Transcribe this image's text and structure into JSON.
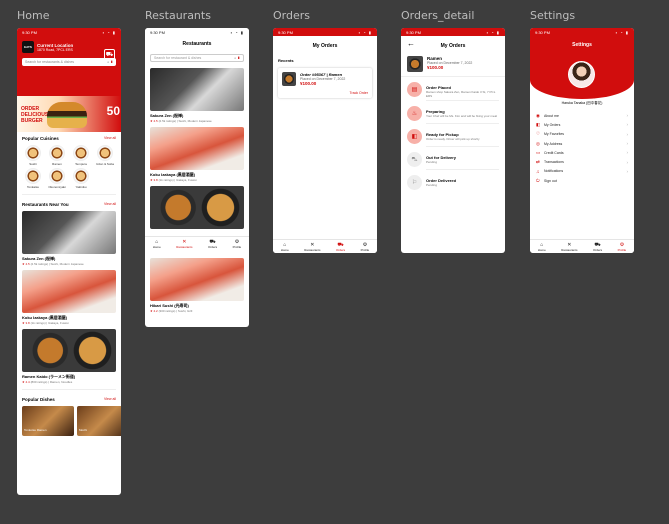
{
  "frames": {
    "home": "Home",
    "restaurants": "Restaurants",
    "orders": "Orders",
    "orders_detail": "Orders_detail",
    "settings": "Settings"
  },
  "status": {
    "time": "9:30 PM"
  },
  "home": {
    "location_title": "Current Location",
    "location_sub": "1870 Road, 7PCL ERS",
    "logo": "EATS",
    "search_placeholder": "Search for restaurants & dishes",
    "banner_text1": "ORDER",
    "banner_text2": "DELICIOUS",
    "banner_text3": "BURGER",
    "banner_discount": "50",
    "popular_cuisines": "Popular Cuisines",
    "view_all": "View all",
    "cuisines": [
      {
        "label": "Sushi"
      },
      {
        "label": "Ramen"
      },
      {
        "label": "Tempura"
      },
      {
        "label": "Udon & Soba"
      },
      {
        "label": "Tonkatsu"
      },
      {
        "label": "Okonomiyaki"
      },
      {
        "label": "Yakiniku"
      }
    ],
    "restaurants_near": "Restaurants Near You",
    "restaurants": [
      {
        "name": "Sakura Zen (桜禅)",
        "rating": "4.5",
        "meta": "(2.5k ratings) | Sushi, Modern Japanese"
      },
      {
        "name": "Koku Izakaya (黒居酒屋)",
        "rating": "3.8",
        "meta": "(1k ratings) | Izakaya, Fusion"
      },
      {
        "name": "Ramen Kaido (ラーメン街道)",
        "rating": "4.4",
        "meta": "(800 ratings) | Ramen, Noodles"
      }
    ],
    "popular_dishes": "Popular Dishes",
    "dishes": [
      {
        "label": "Tonkotsu Ramen"
      },
      {
        "label": "Mochi"
      }
    ]
  },
  "restaurants_page": {
    "title": "Restaurants",
    "search_placeholder": "Search for restaurant & dishes",
    "items": [
      {
        "name": "Sakura Zen (桜禅)",
        "rating": "4.5",
        "meta": "(2.5k ratings) | Sushi, Modern Japanese"
      },
      {
        "name": "Koku Izakaya (黒居酒屋)",
        "rating": "3.8",
        "meta": "(1k ratings) | Izakaya, Fusion"
      },
      {
        "name": "Ramen Kaido (ラーメン街道)",
        "rating": "4.4",
        "meta": "(800 ratings) | Ramen"
      },
      {
        "name": "Hikari Sushi (光寿司)",
        "rating": "4.2",
        "meta": "(300 ratings) | Sushi, Grill"
      }
    ]
  },
  "nav": {
    "home": "Home",
    "restaurants": "Restaurants",
    "orders": "Orders",
    "profile": "Profile"
  },
  "orders_page": {
    "title": "My Orders",
    "recents": "Recents",
    "order_id": "Order #95367 | Ramen",
    "order_date": "Placed on December 7, 2022",
    "price": "¥100.00",
    "track": "Track Order"
  },
  "orders_detail": {
    "title": "My Orders",
    "item_name": "Ramen",
    "item_sub": "Placed on December 7, 2022",
    "price": "¥100.00",
    "steps": [
      {
        "title": "Order Placed",
        "desc": "Ramen shop Sakura Zen, Ramen Kaido 3 St, 7 PCL ERS",
        "done": true
      },
      {
        "title": "Preparing",
        "desc": "Your Chef will be Ms. Kim and will be fixing your meal",
        "done": true
      },
      {
        "title": "Ready for Pickup",
        "desc": "Order is ready. Driver will pick up shortly",
        "done": true
      },
      {
        "title": "Out for Delivery",
        "desc": "Pending",
        "done": false
      },
      {
        "title": "Order Delivered",
        "desc": "Pending",
        "done": false
      }
    ]
  },
  "settings_page": {
    "title": "Settings",
    "user_name": "Haruka Tanaka (田中春花)",
    "menu": [
      {
        "label": "About me",
        "icon": "user-icon"
      },
      {
        "label": "My Orders",
        "icon": "bag-icon"
      },
      {
        "label": "My Favorites",
        "icon": "heart-icon"
      },
      {
        "label": "My Address",
        "icon": "location-icon"
      },
      {
        "label": "Credit Cards",
        "icon": "card-icon"
      },
      {
        "label": "Transactions",
        "icon": "transactions-icon"
      },
      {
        "label": "Notifications",
        "icon": "bell-icon"
      },
      {
        "label": "Sign out",
        "icon": "signout-icon"
      }
    ]
  },
  "colors": {
    "accent": "#d10d0d",
    "frame_bg": "#3d3d3d",
    "label": "#bdbdbd"
  }
}
